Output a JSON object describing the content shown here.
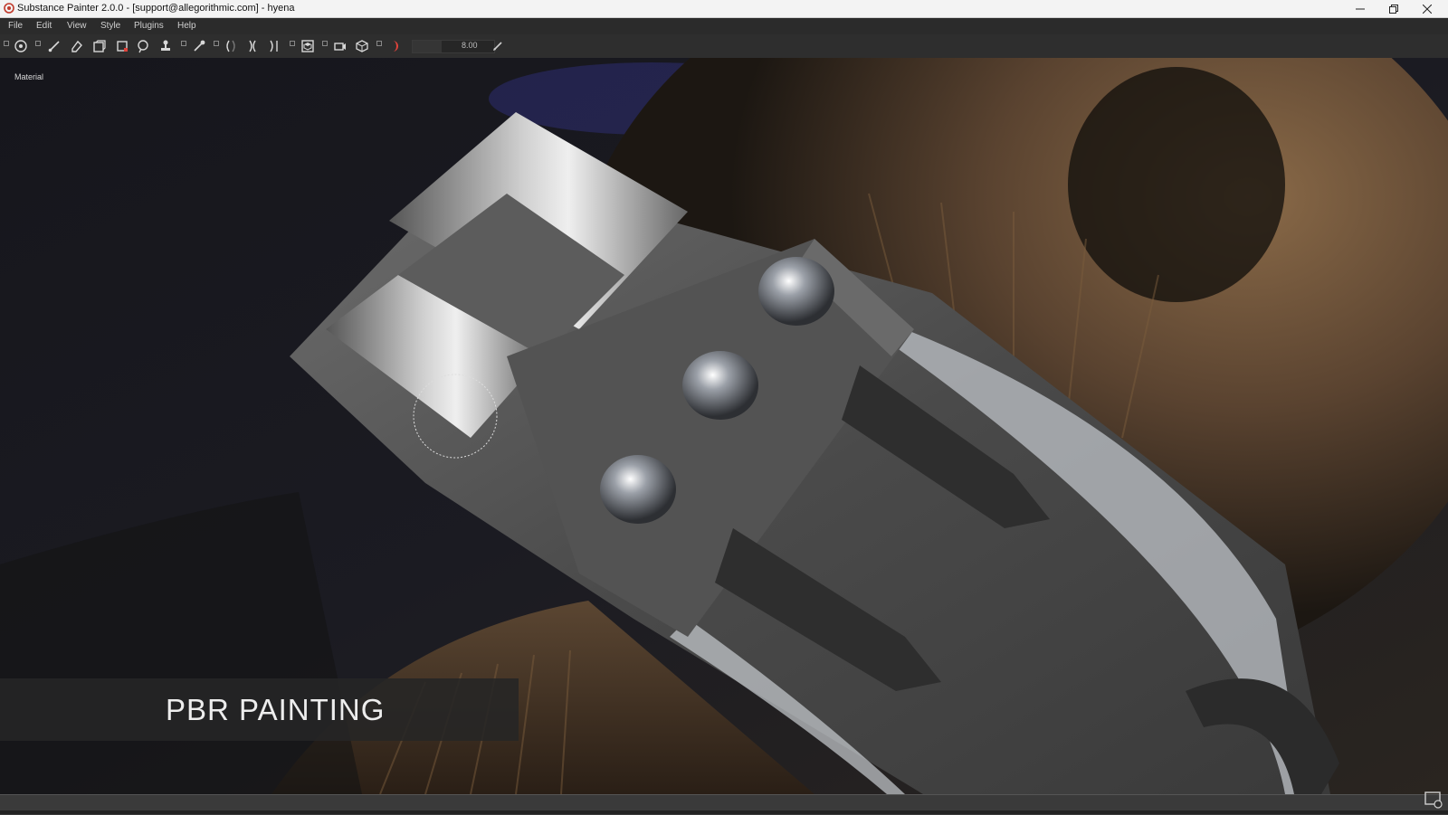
{
  "window": {
    "title": "Substance Painter 2.0.0 - [support@allegorithmic.com] - hyena",
    "controls": [
      "minimize-icon",
      "restore-icon",
      "close-icon"
    ]
  },
  "menu": {
    "items": [
      "File",
      "Edit",
      "View",
      "Style",
      "Plugins",
      "Help"
    ]
  },
  "toolbar": {
    "tools": [
      "transform-icon",
      "paint-brush-icon",
      "eraser-icon",
      "projection-icon",
      "polygon-fill-icon",
      "smudge-icon",
      "clone-stamp-icon",
      "material-picker-icon",
      "symmetry-left-icon",
      "symmetry-mid-icon",
      "symmetry-right-icon",
      "display-3d-icon",
      "camera-icon",
      "cube-icon",
      "moon-icon"
    ],
    "brush_size": "8.00",
    "brush_fill_fraction": 0.36
  },
  "viewport": {
    "mode_label": "Material",
    "caption": "PBR PAINTING"
  },
  "colors": {
    "titlebar": "#f3f3f3",
    "menubar": "#2b2b2b",
    "toolbar": "#2e2e2e",
    "app_icon": "#c0392b"
  }
}
